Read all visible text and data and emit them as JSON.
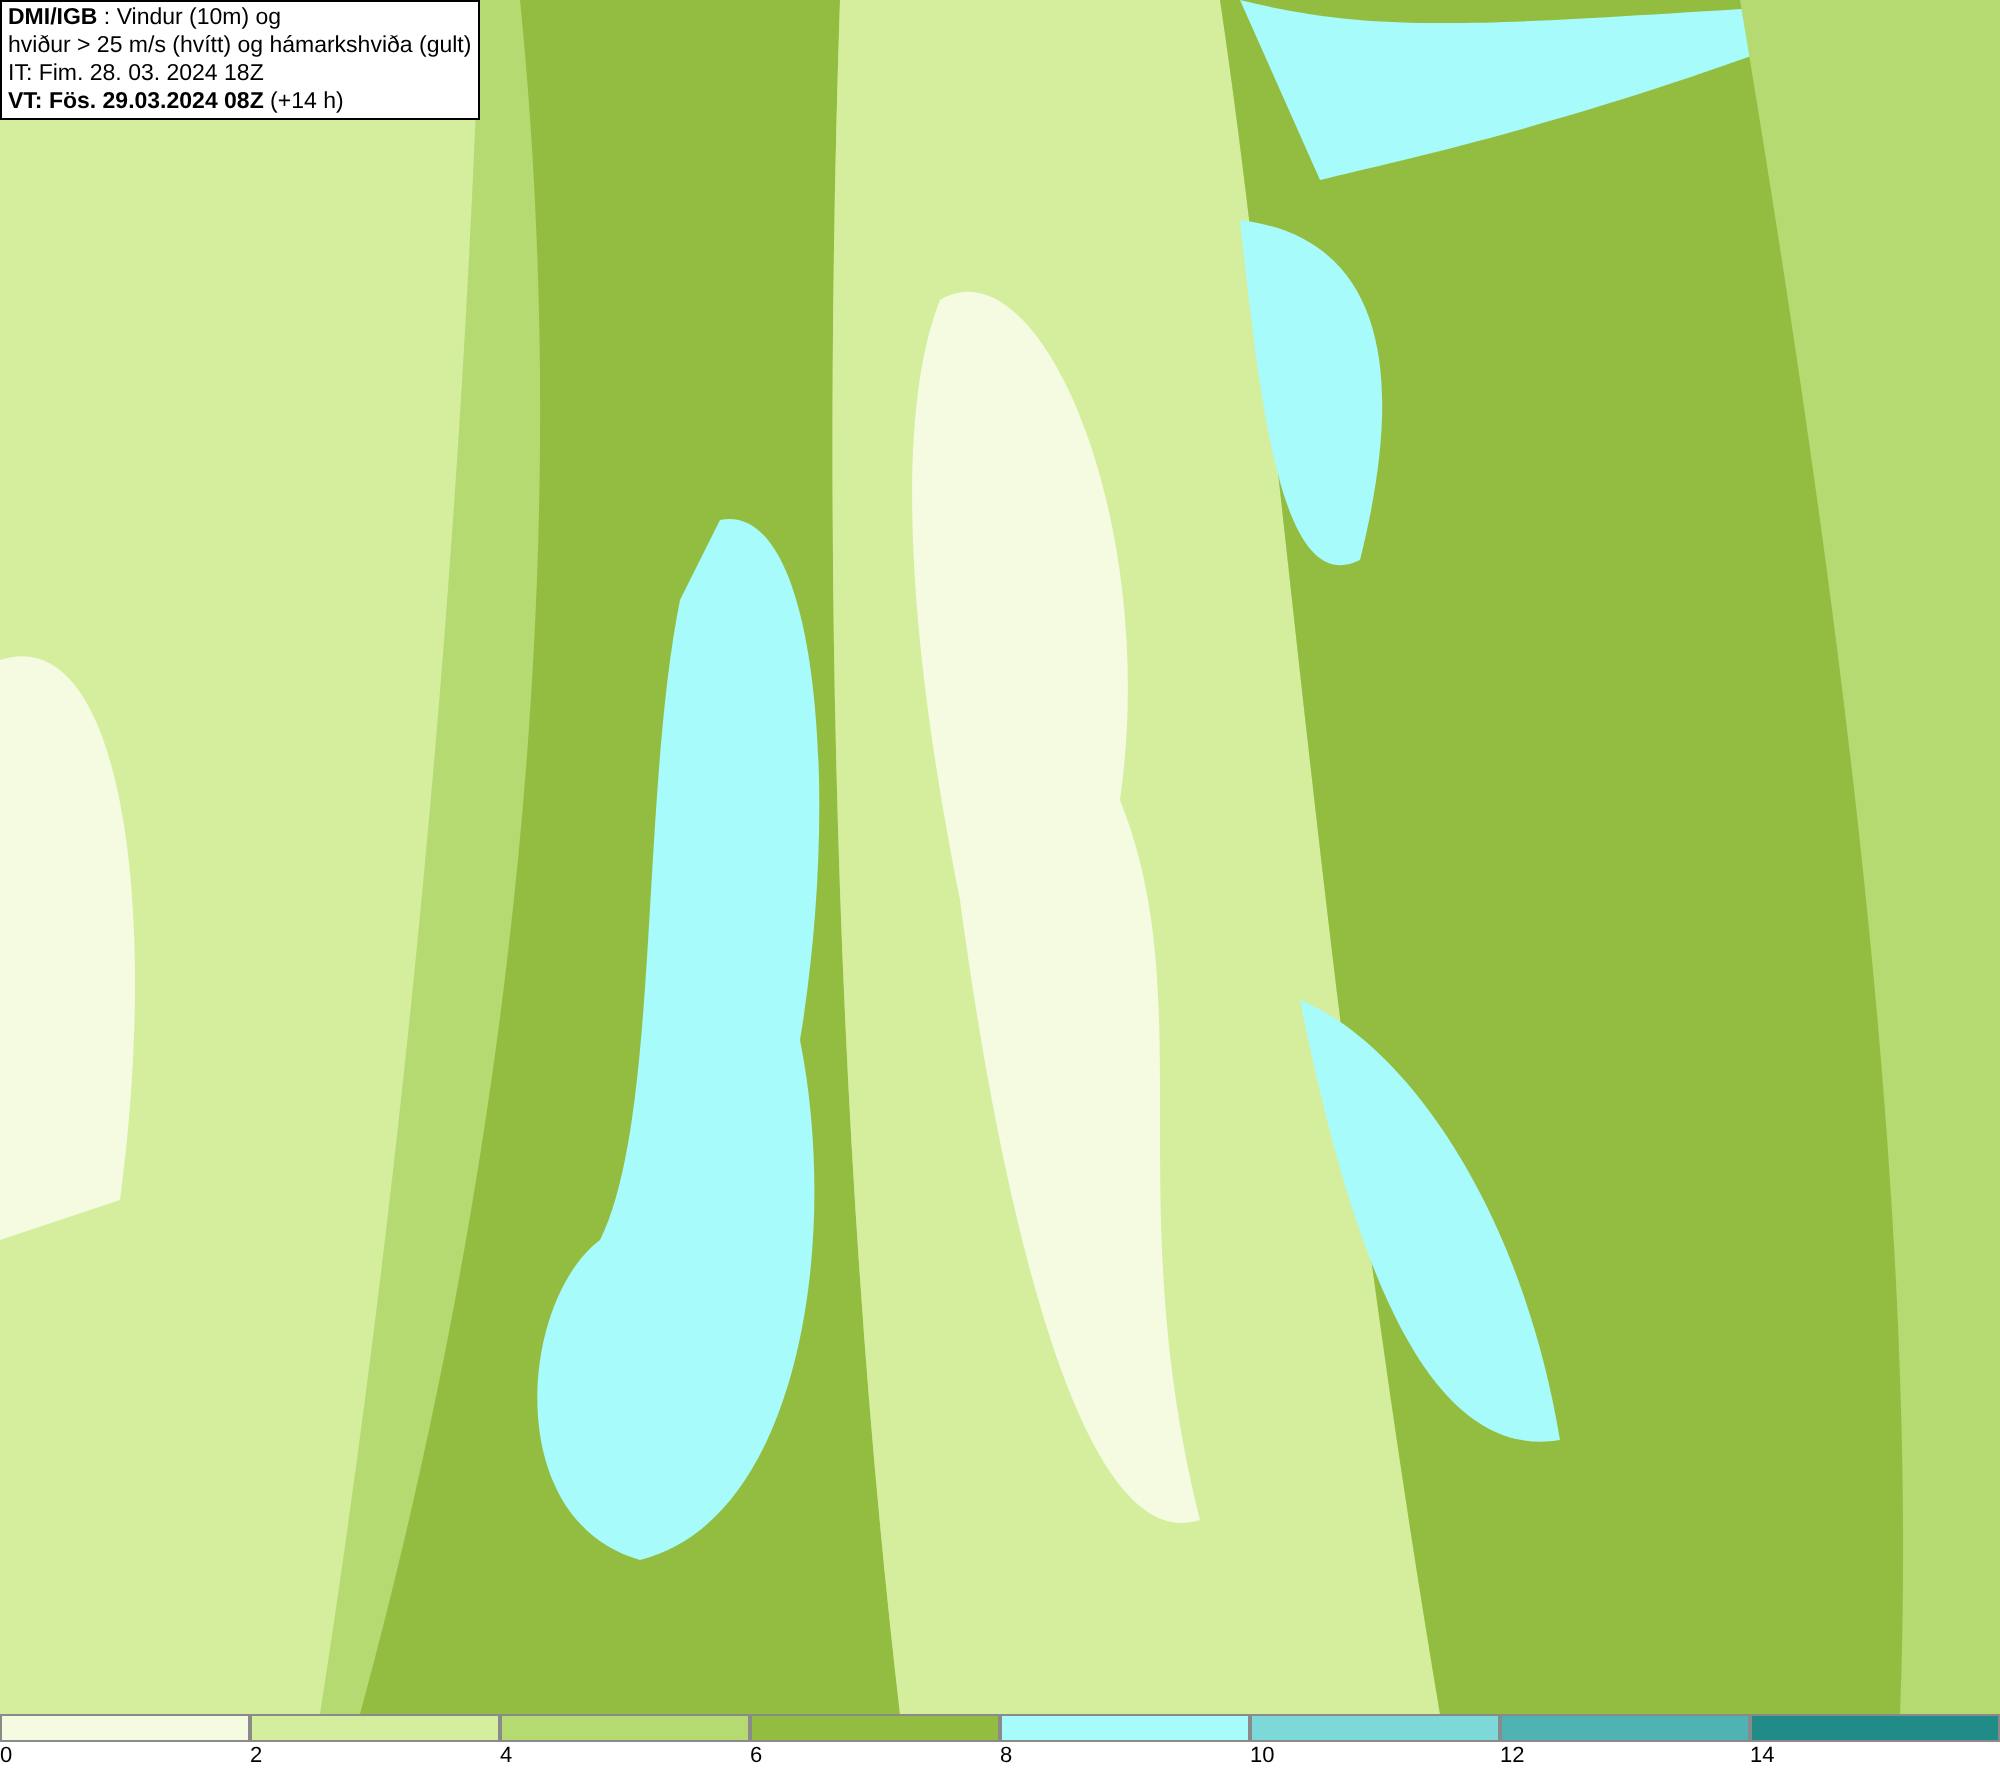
{
  "map": {
    "header": [
      "**DMI/IGB** : Vindur (10m) og",
      "hviður > 25 m/s (hvítt) og hámarkshviða (gult)",
      "IT: Fim. 28. 03. 2024 18Z",
      "**VT: Fös. 29.03.2024 08Z** (+14 h)"
    ]
  },
  "legend": [
    {
      "label": "0",
      "color": "#f4fbe0"
    },
    {
      "label": "2",
      "color": "#d4ee9e"
    },
    {
      "label": "4",
      "color": "#b5da72"
    },
    {
      "label": "6",
      "color": "#93bd40"
    },
    {
      "label": "8",
      "color": "#a7fbfb"
    },
    {
      "label": "10",
      "color": "#7dd8d8"
    },
    {
      "label": "12",
      "color": "#50b3b3"
    },
    {
      "label": "14",
      "color": "#218c87"
    }
  ]
}
